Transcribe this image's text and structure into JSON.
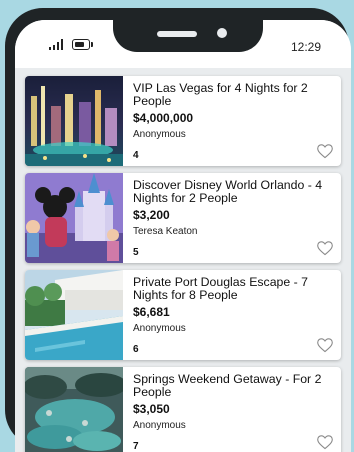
{
  "status_bar": {
    "time": "12:29"
  },
  "items": [
    {
      "title": "VIP Las Vegas for 4 Nights for 2 People",
      "price": "$4,000,000",
      "donor": "Anonymous",
      "count": "4",
      "image": "las-vegas-strip-night"
    },
    {
      "title": "Discover Disney World Orlando - 4 Nights for 2 People",
      "price": "$3,200",
      "donor": "Teresa Keaton",
      "count": "5",
      "image": "disney-castle-characters"
    },
    {
      "title": "Private Port Douglas Escape - 7 Nights for 8 People",
      "price": "$6,681",
      "donor": "Anonymous",
      "count": "6",
      "image": "resort-pool-palms"
    },
    {
      "title": "Springs Weekend Getaway - For 2 People",
      "price": "$3,050",
      "donor": "Anonymous",
      "count": "7",
      "image": "hot-springs-valley"
    }
  ],
  "colors": {
    "background": "#a9d8e3",
    "card": "#ffffff",
    "screen": "#e9ecee",
    "phone": "#1f2426"
  }
}
